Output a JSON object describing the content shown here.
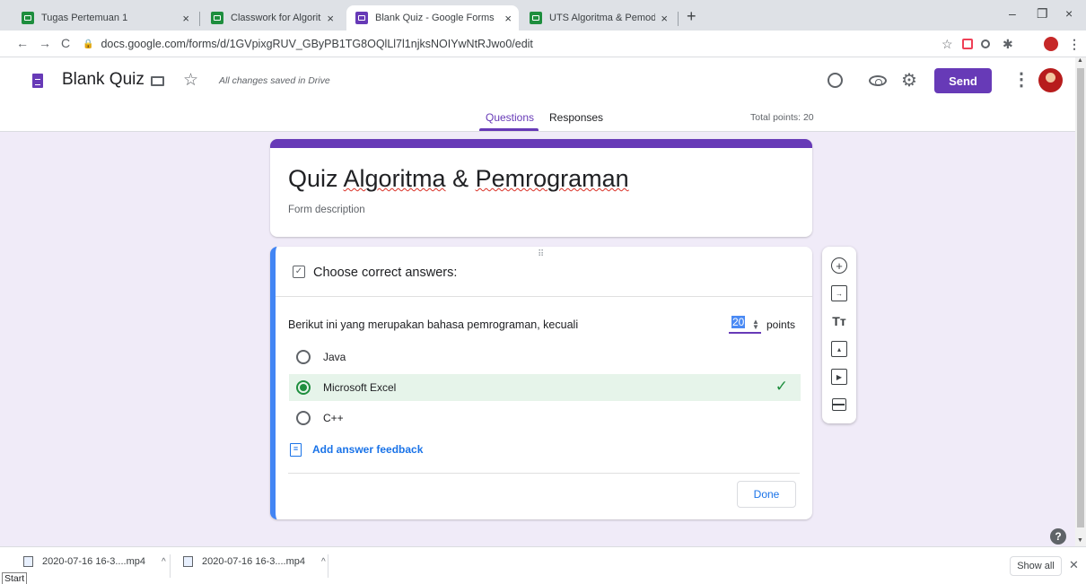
{
  "browser": {
    "tabs": [
      {
        "title": "Tugas Pertemuan 1",
        "favicon": "classroom-icon"
      },
      {
        "title": "Classwork for Algoritma & Pemro",
        "favicon": "classroom-icon"
      },
      {
        "title": "Blank Quiz - Google Forms",
        "favicon": "forms-icon",
        "active": true
      },
      {
        "title": "UTS Algoritma & Pemodelan",
        "favicon": "classroom-icon"
      }
    ],
    "tab_close": "×",
    "new_tab": "+",
    "url": "docs.google.com/forms/d/1GVpixgRUV_GByPB1TG8OQlLl7l1njksNOIYwNtRJwo0/edit",
    "window_controls": [
      "–",
      "❐",
      "×"
    ]
  },
  "header": {
    "doc_title": "Blank Quiz",
    "save_status": "All changes saved in Drive",
    "send_label": "Send",
    "tabs": {
      "questions": "Questions",
      "responses": "Responses"
    },
    "total_points": "Total points: 20"
  },
  "form": {
    "title_parts": [
      "Quiz ",
      "Algoritma",
      " & ",
      "Pemrograman"
    ],
    "description_placeholder": "Form description"
  },
  "question_card": {
    "section_title": "Choose correct answers:",
    "question_text": "Berikut ini yang merupakan bahasa pemrograman, kecuali",
    "points_value": "20",
    "points_label": "points",
    "options": [
      {
        "label": "Java",
        "correct": false
      },
      {
        "label": "Microsoft Excel",
        "correct": true
      },
      {
        "label": "C++",
        "correct": false
      }
    ],
    "feedback_label": "Add answer feedback",
    "done_label": "Done"
  },
  "floating_toolbar": [
    "add-question-icon",
    "import-questions-icon",
    "add-title-icon",
    "add-image-icon",
    "add-video-icon",
    "add-section-icon"
  ],
  "downloads": {
    "items": [
      "2020-07-16 16-3....mp4",
      "2020-07-16 16-3....mp4"
    ],
    "show_all": "Show all",
    "start": "Start"
  },
  "colors": {
    "accent": "#673ab7",
    "correct": "#1e8e3e",
    "link": "#1a73e8",
    "focus_border": "#4285f4"
  }
}
